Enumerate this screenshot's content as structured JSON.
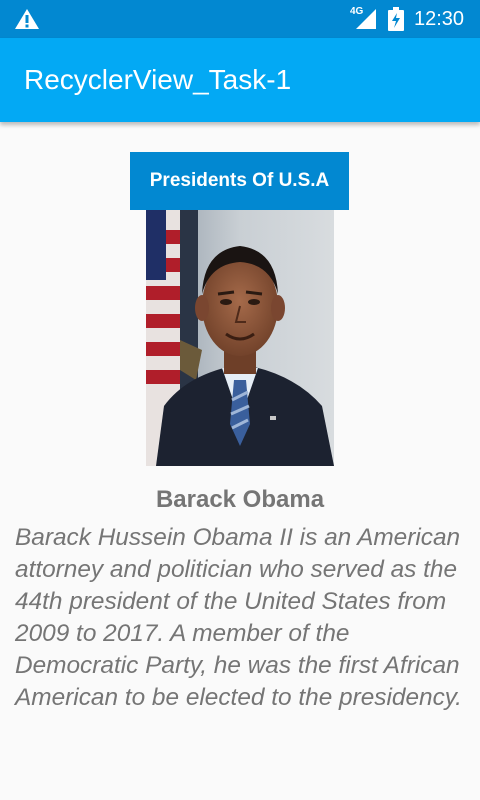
{
  "status_bar": {
    "time": "12:30",
    "network": "4G",
    "icons": [
      "warning-icon",
      "signal-icon",
      "battery-charging-icon"
    ]
  },
  "app_bar": {
    "title": "RecyclerView_Task-1"
  },
  "list": {
    "header_label": "Presidents Of U.S.A",
    "item": {
      "name": "Barack Obama",
      "description": "Barack Hussein Obama II is an American attorney and politician who served as the 44th president of the United States from 2009 to 2017. A member of the Democratic Party, he was the first African American to be elected to the presidency."
    }
  },
  "colors": {
    "status_bar": "#0288d1",
    "app_bar": "#03a9f4",
    "header_button": "#0288d1",
    "text_gray": "#757575"
  }
}
